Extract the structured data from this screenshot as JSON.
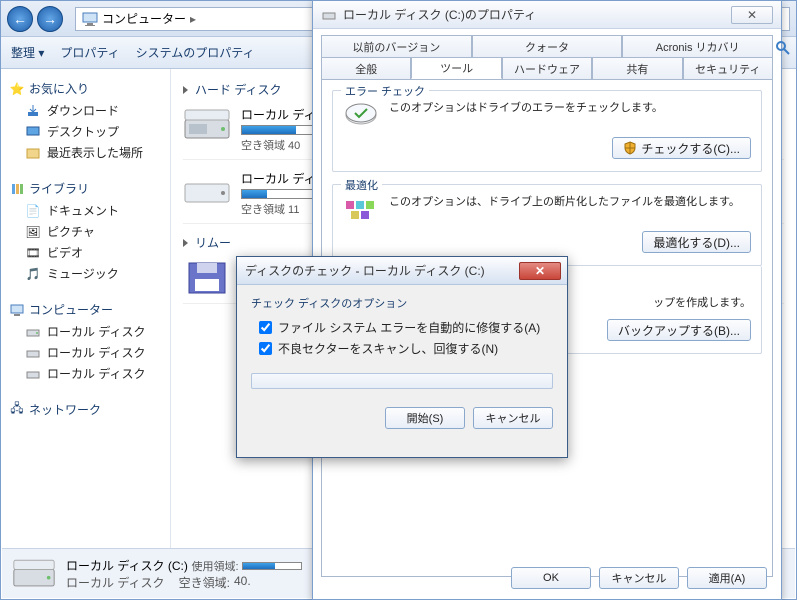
{
  "explorer": {
    "breadcrumb": "コンピューター",
    "arrow": "▸",
    "cmdbar": {
      "organize": "整理 ▾",
      "properties": "プロパティ",
      "sys_props": "システムのプロパティ"
    },
    "sidebar": {
      "favorites": {
        "head": "お気に入り",
        "items": [
          "ダウンロード",
          "デスクトップ",
          "最近表示した場所"
        ]
      },
      "libraries": {
        "head": "ライブラリ",
        "items": [
          "ドキュメント",
          "ピクチャ",
          "ビデオ",
          "ミュージック"
        ]
      },
      "computer": {
        "head": "コンピューター",
        "items": [
          "ローカル ディスク",
          "ローカル ディスク",
          "ローカル ディスク"
        ]
      },
      "network": {
        "head": "ネットワーク"
      }
    },
    "main": {
      "hdd_head": "ハード ディスク",
      "drive1": {
        "name": "ローカル ディ",
        "free": "空き領域 40"
      },
      "drive2": {
        "name": "ローカル ディ",
        "free": "空き領域 11"
      },
      "removable_head": "リムー"
    },
    "status": {
      "name": "ローカル ディスク (C:)",
      "type": "ローカル ディスク",
      "used_label": "使用領域:",
      "free_label": "空き領域:",
      "free_val": "40."
    }
  },
  "props": {
    "title": "ローカル ディスク (C:)のプロパティ",
    "close_glyph": "✕",
    "tabs_row1": [
      "以前のバージョン",
      "クォータ",
      "Acronis リカバリ"
    ],
    "tabs_row2": [
      "全般",
      "ツール",
      "ハードウェア",
      "共有",
      "セキュリティ"
    ],
    "error_check": {
      "title": "エラー チェック",
      "desc": "このオプションはドライブのエラーをチェックします。",
      "button": "チェックする(C)..."
    },
    "optimize": {
      "title": "最適化",
      "desc": "このオプションは、ドライブ上の断片化したファイルを最適化します。",
      "button": "最適化する(D)..."
    },
    "backup": {
      "desc": "ップを作成します。",
      "button": "バックアップする(B)..."
    },
    "buttons": {
      "ok": "OK",
      "cancel": "キャンセル",
      "apply": "適用(A)"
    }
  },
  "chkdsk": {
    "title": "ディスクのチェック - ローカル ディスク (C:)",
    "close_glyph": "✕",
    "group_title": "チェック ディスクのオプション",
    "opt1": "ファイル システム エラーを自動的に修復する(A)",
    "opt2": "不良セクターをスキャンし、回復する(N)",
    "start": "開始(S)",
    "cancel": "キャンセル"
  }
}
